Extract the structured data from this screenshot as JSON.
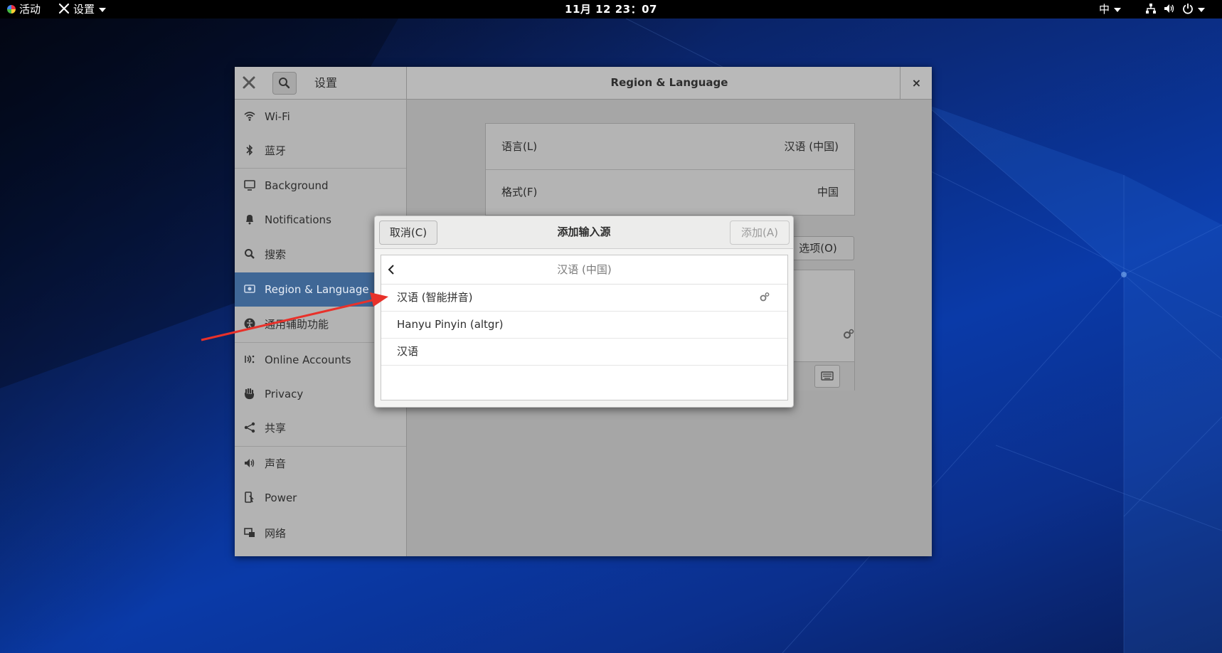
{
  "topbar": {
    "activities": "活动",
    "app_menu": "设置",
    "clock": "11月 12  23：07",
    "ime": "中"
  },
  "window": {
    "app_name": "设置",
    "title": "Region & Language",
    "close": "×"
  },
  "sidebar": {
    "items": [
      {
        "label": "Wi-Fi",
        "icon": "wifi-icon"
      },
      {
        "label": "蓝牙",
        "icon": "bluetooth-icon"
      },
      {
        "label": "Background",
        "icon": "background-icon"
      },
      {
        "label": "Notifications",
        "icon": "bell-icon"
      },
      {
        "label": "搜索",
        "icon": "search-icon"
      },
      {
        "label": "Region & Language",
        "icon": "region-icon",
        "active": true
      },
      {
        "label": "通用辅助功能",
        "icon": "accessibility-icon"
      },
      {
        "label": "Online Accounts",
        "icon": "online-accounts-icon"
      },
      {
        "label": "Privacy",
        "icon": "hand-icon"
      },
      {
        "label": "共享",
        "icon": "share-icon"
      },
      {
        "label": "声音",
        "icon": "speaker-icon"
      },
      {
        "label": "Power",
        "icon": "power-plug-icon"
      },
      {
        "label": "网络",
        "icon": "network-icon"
      }
    ]
  },
  "region": {
    "language_label": "语言(L)",
    "language_value": "汉语 (中国)",
    "format_label": "格式(F)",
    "format_value": "中国",
    "options_button": "选项(O)"
  },
  "dialog": {
    "cancel": "取消(C)",
    "title": "添加输入源",
    "add": "添加(A)",
    "list_header": "汉语 (中国)",
    "rows": [
      {
        "label": "汉语 (智能拼音)",
        "has_settings": true
      },
      {
        "label": "Hanyu Pinyin (altgr)",
        "has_settings": false
      },
      {
        "label": "汉语",
        "has_settings": false
      }
    ]
  },
  "colors": {
    "selection": "#3f6796",
    "annotation_arrow": "#e8312a"
  }
}
